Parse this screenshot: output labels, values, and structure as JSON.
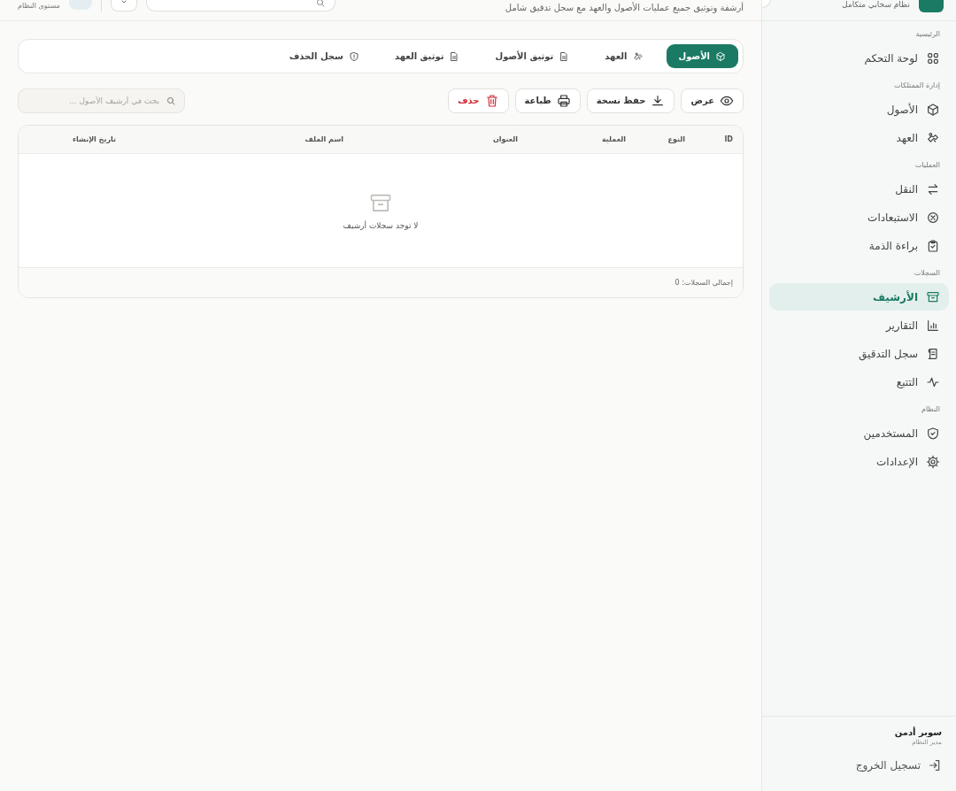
{
  "header": {
    "brand": "نظام سحابي متكامل",
    "subtitle": "أرشفة وتوثيق جميع عمليات الأصول والعهد مع سجل تدقيق شامل",
    "level_label": "مستوى النظام"
  },
  "sidebar": {
    "sections": [
      {
        "title": "الرئيسية",
        "items": [
          {
            "label": "لوحة التحكم",
            "selected": false
          }
        ]
      },
      {
        "title": "إدارة الممتلكات",
        "items": [
          {
            "label": "الأصول",
            "selected": false
          },
          {
            "label": "العهد",
            "selected": false
          }
        ]
      },
      {
        "title": "العمليات",
        "items": [
          {
            "label": "النقل",
            "selected": false
          },
          {
            "label": "الاستبعادات",
            "selected": false
          },
          {
            "label": "براءة الذمة",
            "selected": false
          }
        ]
      },
      {
        "title": "السجلات",
        "items": [
          {
            "label": "الأرشيف",
            "selected": true
          },
          {
            "label": "التقارير",
            "selected": false
          },
          {
            "label": "سجل التدقيق",
            "selected": false
          },
          {
            "label": "التتبع",
            "selected": false
          }
        ]
      },
      {
        "title": "النظام",
        "items": [
          {
            "label": "المستخدمين",
            "selected": false
          },
          {
            "label": "الإعدادات",
            "selected": false
          }
        ]
      }
    ],
    "user": {
      "name": "سوبر أدمن",
      "role": "مدير النظام"
    },
    "logout": "تسجيل الخروج"
  },
  "tabs": [
    {
      "label": "الأصول",
      "selected": true
    },
    {
      "label": "العهد",
      "selected": false
    },
    {
      "label": "توثيق الأصول",
      "selected": false
    },
    {
      "label": "توثيق العهد",
      "selected": false
    },
    {
      "label": "سجل الحذف",
      "selected": false
    }
  ],
  "actions": [
    {
      "label": "عرض",
      "kind": "default"
    },
    {
      "label": "حفظ نسخة",
      "kind": "default"
    },
    {
      "label": "طباعة",
      "kind": "default"
    },
    {
      "label": "حذف",
      "kind": "danger"
    }
  ],
  "search": {
    "placeholder": "بحث في أرشيف الأصول ..."
  },
  "table": {
    "columns": [
      "ID",
      "النوع",
      "العملية",
      "العنوان",
      "اسم الملف",
      "تاريخ الإنشاء"
    ],
    "empty_message": "لا توجد سجلات أرشيف",
    "total": "إجمالي السجلات: 0"
  }
}
